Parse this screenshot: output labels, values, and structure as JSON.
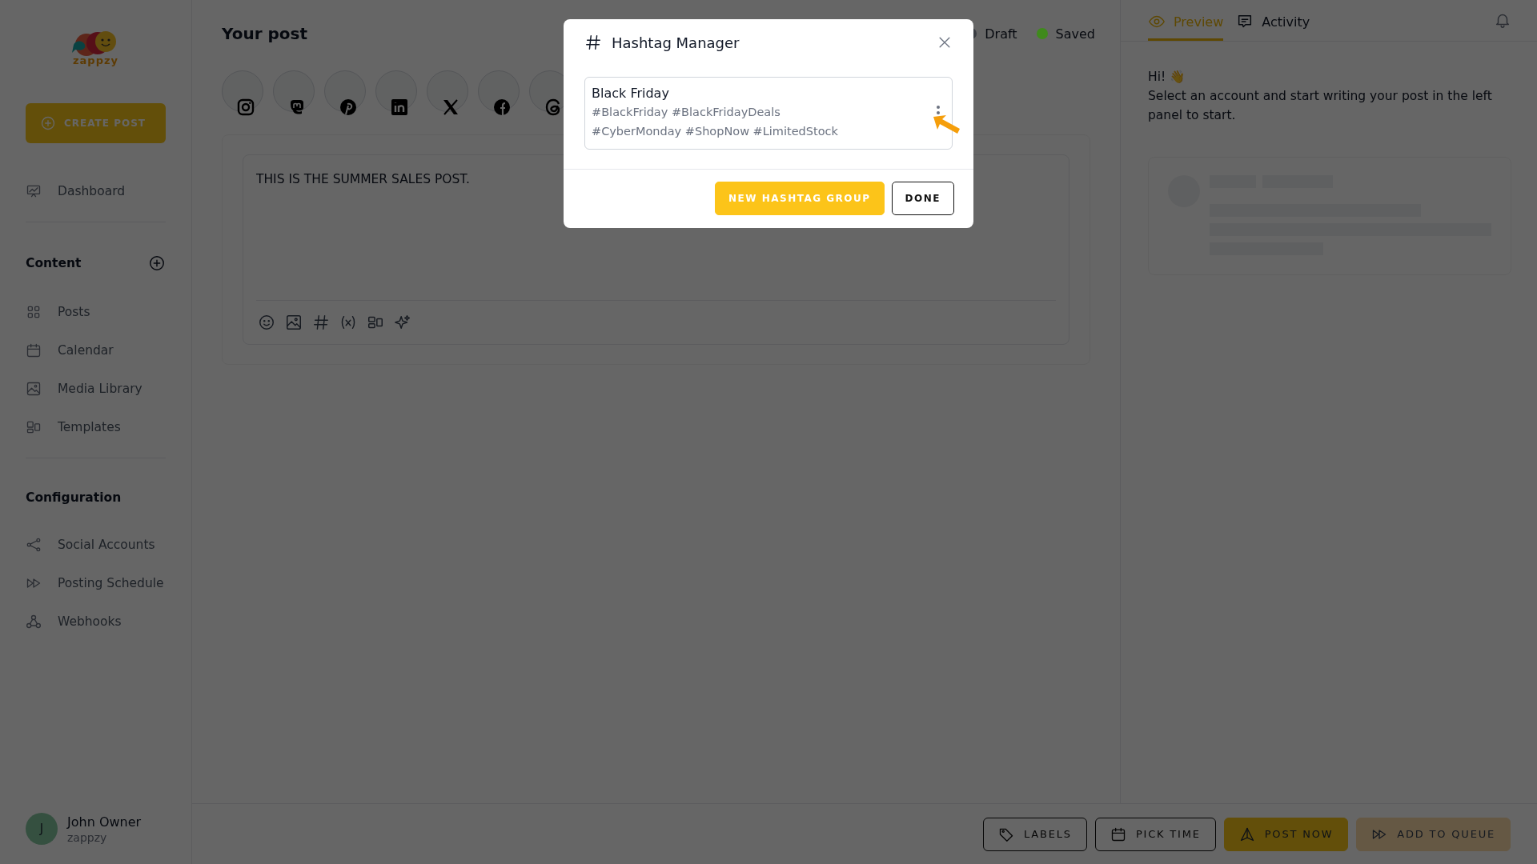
{
  "sidebar": {
    "logo_text": "zappzy",
    "create_button": "CREATE POST",
    "top_items": [
      {
        "label": "Dashboard"
      }
    ],
    "sections": [
      {
        "title": "Content",
        "add_button": true,
        "items": [
          {
            "label": "Posts"
          },
          {
            "label": "Calendar"
          },
          {
            "label": "Media Library"
          },
          {
            "label": "Templates"
          }
        ]
      },
      {
        "title": "Configuration",
        "add_button": false,
        "items": [
          {
            "label": "Social Accounts"
          },
          {
            "label": "Posting Schedule"
          },
          {
            "label": "Webhooks"
          }
        ]
      }
    ],
    "user": {
      "initial": "J",
      "name": "John Owner",
      "workspace": "zappzy"
    }
  },
  "editor": {
    "title": "Your post",
    "statuses": [
      {
        "label": "Draft",
        "color": "#3a3d42"
      },
      {
        "label": "Saved",
        "color": "#3f8a1c"
      }
    ],
    "text": "THIS IS THE SUMMER SALES POST."
  },
  "preview": {
    "tabs": [
      {
        "label": "Preview",
        "selected": true
      },
      {
        "label": "Activity",
        "selected": false
      }
    ],
    "greeting": "Hi! 👋",
    "message": "Select an account and start writing your post in the left panel to start."
  },
  "actions": [
    {
      "label": "LABELS",
      "kind": "outline"
    },
    {
      "label": "PICK TIME",
      "kind": "outline"
    },
    {
      "label": "POST NOW",
      "kind": "primary"
    },
    {
      "label": "ADD TO QUEUE",
      "kind": "secondary"
    }
  ],
  "dialog": {
    "title": "Hashtag Manager",
    "groups": [
      {
        "name": "Black Friday",
        "hashtags": "#BlackFriday #BlackFridayDeals #CyberMonday #ShopNow #LimitedStock"
      }
    ],
    "buttons": [
      {
        "label": "NEW HASHTAG GROUP",
        "kind": "primary"
      },
      {
        "label": "DONE",
        "kind": "outline"
      }
    ]
  }
}
